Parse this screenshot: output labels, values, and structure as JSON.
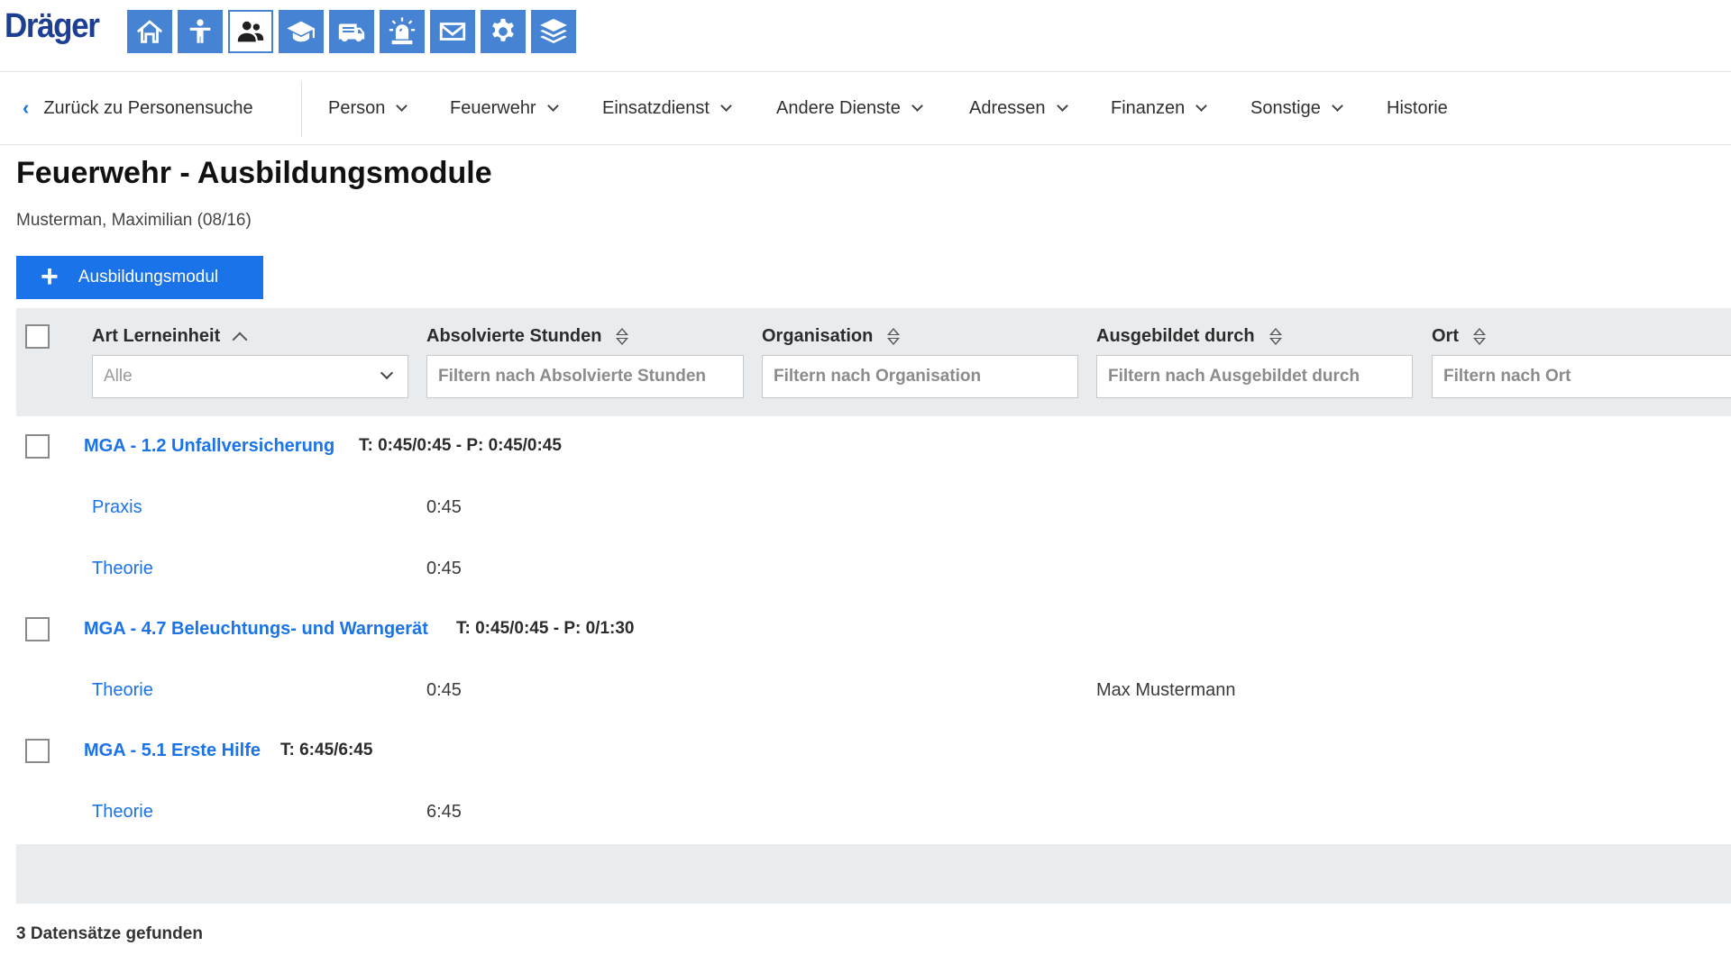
{
  "brand": {
    "logo_text": "Dräger",
    "accent": "#1a73e8",
    "icon_blue": "#4683d3"
  },
  "app_icons": [
    {
      "name": "home-icon",
      "active": false
    },
    {
      "name": "person-icon",
      "active": false
    },
    {
      "name": "persons-icon",
      "active": true
    },
    {
      "name": "graduation-cap-icon",
      "active": false
    },
    {
      "name": "fire-truck-icon",
      "active": false
    },
    {
      "name": "siren-icon",
      "active": false
    },
    {
      "name": "mail-icon",
      "active": false
    },
    {
      "name": "gear-icon",
      "active": false
    },
    {
      "name": "layers-icon",
      "active": false
    }
  ],
  "nav": {
    "back_label": "Zurück zu Personensuche",
    "items": [
      "Person",
      "Feuerwehr",
      "Einsatzdienst",
      "Andere Dienste",
      "Adressen",
      "Finanzen",
      "Sonstige",
      "Historie"
    ]
  },
  "page": {
    "title": "Feuerwehr - Ausbildungsmodule",
    "subtitle": "Musterman, Maximilian (08/16)",
    "add_button": "Ausbildungsmodul"
  },
  "table": {
    "columns": [
      {
        "label": "Art Lerneinheit",
        "sort": "asc"
      },
      {
        "label": "Absolvierte Stunden",
        "sort": "none"
      },
      {
        "label": "Organisation",
        "sort": "none"
      },
      {
        "label": "Ausgebildet durch",
        "sort": "none"
      },
      {
        "label": "Ort",
        "sort": "none"
      }
    ],
    "filters": {
      "type_select": "Alle",
      "hours_placeholder": "Filtern nach Absolvierte Stunden",
      "org_placeholder": "Filtern nach Organisation",
      "trainer_placeholder": "Filtern nach Ausgebildet durch",
      "place_placeholder": "Filtern nach Ort"
    },
    "groups": [
      {
        "title": "MGA - 1.2 Unfallversicherung",
        "summary": "T: 0:45/0:45 - P: 0:45/0:45",
        "rows": [
          {
            "type": "Praxis",
            "hours": "0:45",
            "trainer": ""
          },
          {
            "type": "Theorie",
            "hours": "0:45",
            "trainer": ""
          }
        ]
      },
      {
        "title": "MGA - 4.7 Beleuchtungs- und Warngerät",
        "summary": "T: 0:45/0:45 - P: 0/1:30",
        "rows": [
          {
            "type": "Theorie",
            "hours": "0:45",
            "trainer": "Max Mustermann"
          }
        ]
      },
      {
        "title": "MGA - 5.1 Erste Hilfe",
        "summary": "T: 6:45/6:45",
        "rows": [
          {
            "type": "Theorie",
            "hours": "6:45",
            "trainer": ""
          }
        ]
      }
    ]
  },
  "footer": {
    "record_count": "3 Datensätze gefunden"
  }
}
